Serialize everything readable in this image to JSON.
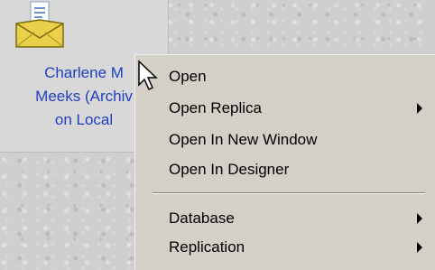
{
  "tile": {
    "label": "Charlene M\nMeeks (Archiv\non Local",
    "icon": "mail-envelope-icon",
    "label_color": "#1f3fbf"
  },
  "context_menu": {
    "items": [
      {
        "label": "Open",
        "has_submenu": false
      },
      {
        "label": "Open Replica",
        "has_submenu": true
      },
      {
        "label": "Open In New Window",
        "has_submenu": false
      },
      {
        "label": "Open In Designer",
        "has_submenu": false
      },
      {
        "label": "Database",
        "has_submenu": true
      },
      {
        "label": "Replication",
        "has_submenu": true
      }
    ],
    "separator_after_index": 3
  },
  "cursor": {
    "icon": "arrow-cursor-icon"
  }
}
